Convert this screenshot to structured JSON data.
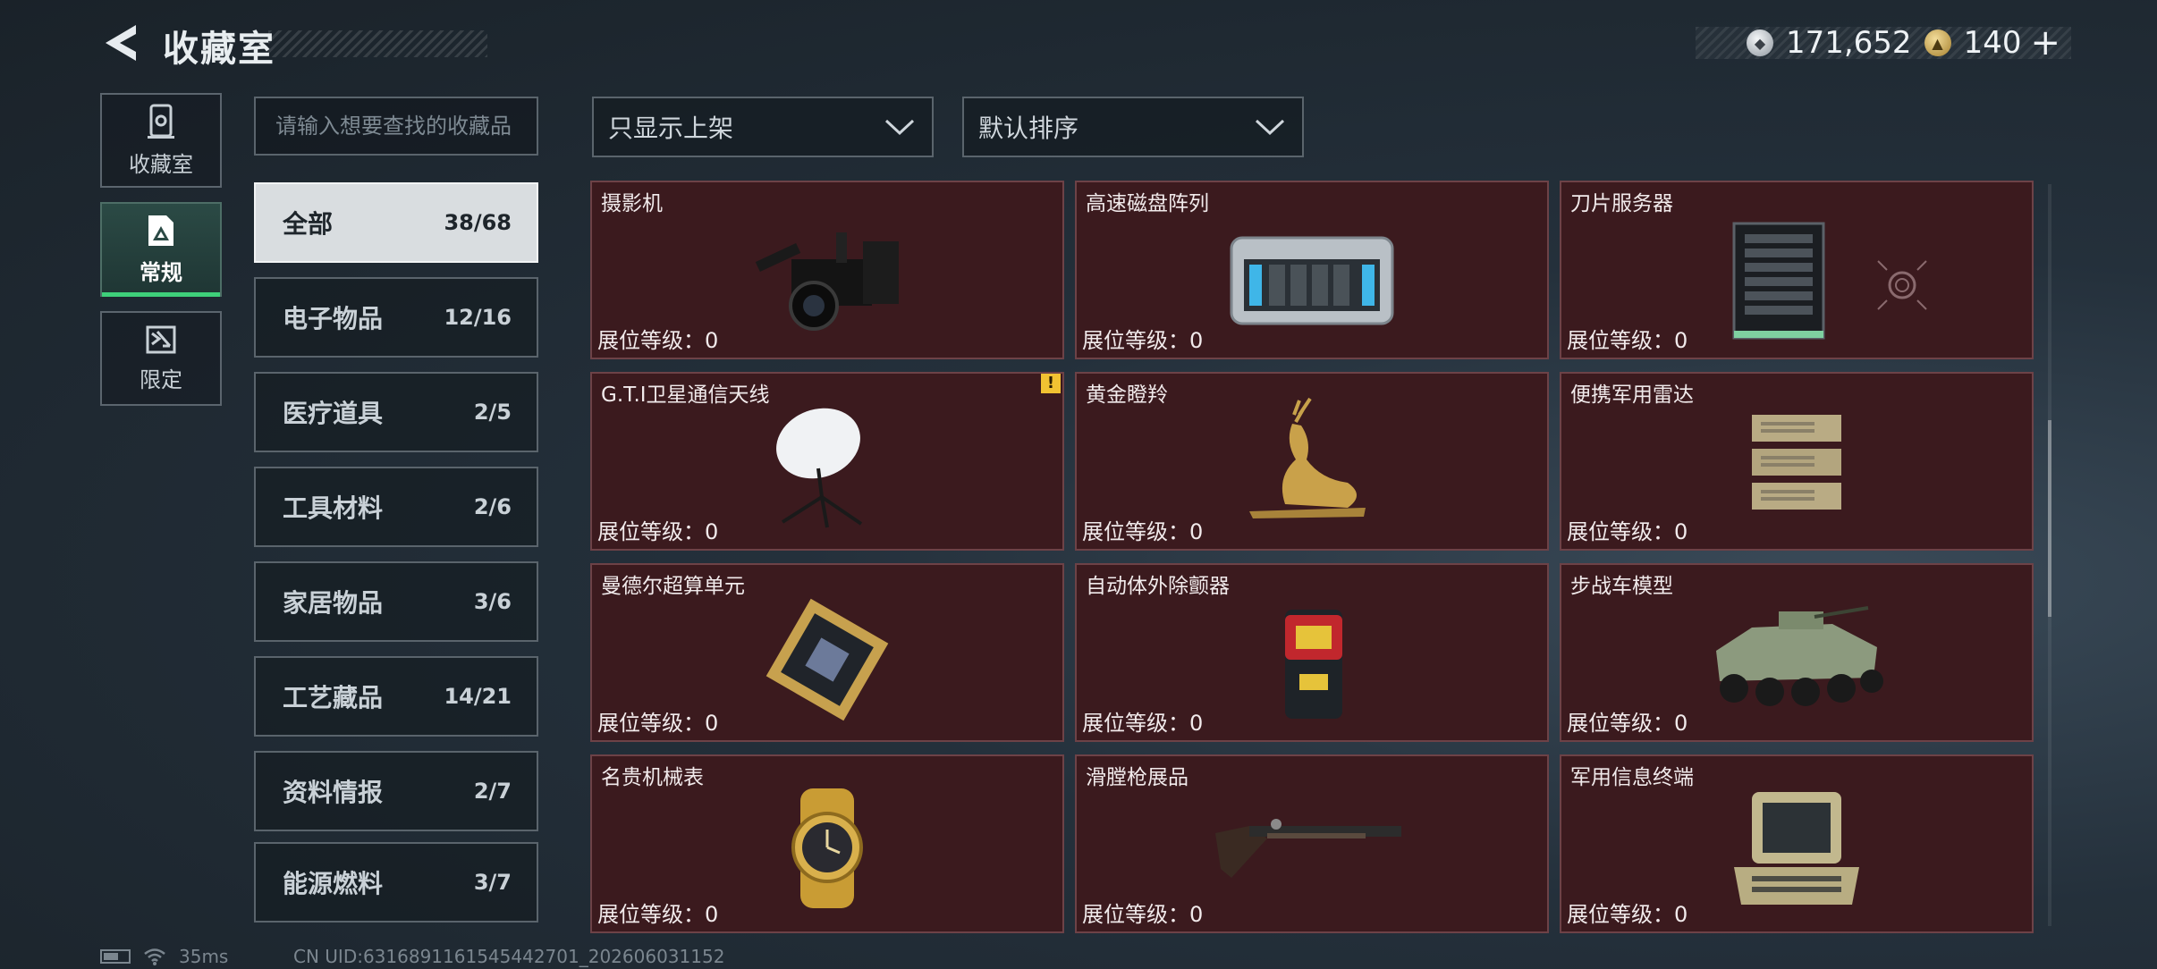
{
  "header": {
    "title": "收藏室"
  },
  "currency": {
    "silver_amount": "171,652",
    "gold_amount": "140",
    "add_label": "+"
  },
  "rail": [
    {
      "label": "收藏室",
      "icon": "collection-icon"
    },
    {
      "label": "常规",
      "icon": "regular-icon",
      "active": true
    },
    {
      "label": "限定",
      "icon": "limited-icon"
    }
  ],
  "search": {
    "placeholder": "请输入想要查找的收藏品"
  },
  "categories": [
    {
      "name": "全部",
      "count": "38/68",
      "active": true
    },
    {
      "name": "电子物品",
      "count": "12/16"
    },
    {
      "name": "医疗道具",
      "count": "2/5"
    },
    {
      "name": "工具材料",
      "count": "2/6"
    },
    {
      "name": "家居物品",
      "count": "3/6"
    },
    {
      "name": "工艺藏品",
      "count": "14/21"
    },
    {
      "name": "资料情报",
      "count": "2/7"
    },
    {
      "name": "能源燃料",
      "count": "3/7"
    }
  ],
  "filters": {
    "listing_filter": "只显示上架",
    "sort": "默认排序"
  },
  "level_label": "展位等级：0",
  "items": [
    {
      "name": "摄影机",
      "icon": "camera-icon"
    },
    {
      "name": "高速磁盘阵列",
      "icon": "disk-array-icon"
    },
    {
      "name": "刀片服务器",
      "icon": "blade-server-icon"
    },
    {
      "name": "G.T.I卫星通信天线",
      "icon": "satellite-dish-icon",
      "warning": "!"
    },
    {
      "name": "黄金瞪羚",
      "icon": "golden-gazelle-icon"
    },
    {
      "name": "便携军用雷达",
      "icon": "radar-icon"
    },
    {
      "name": "曼德尔超算单元",
      "icon": "supercomputer-unit-icon"
    },
    {
      "name": "自动体外除颤器",
      "icon": "defibrillator-icon"
    },
    {
      "name": "步战车模型",
      "icon": "ifv-model-icon"
    },
    {
      "name": "名贵机械表",
      "icon": "watch-icon"
    },
    {
      "name": "滑膛枪展品",
      "icon": "musket-icon"
    },
    {
      "name": "军用信息终端",
      "icon": "terminal-icon"
    }
  ],
  "status": {
    "ping": "35ms",
    "uid": "CN UID:6316891161545442701_202606031152"
  }
}
